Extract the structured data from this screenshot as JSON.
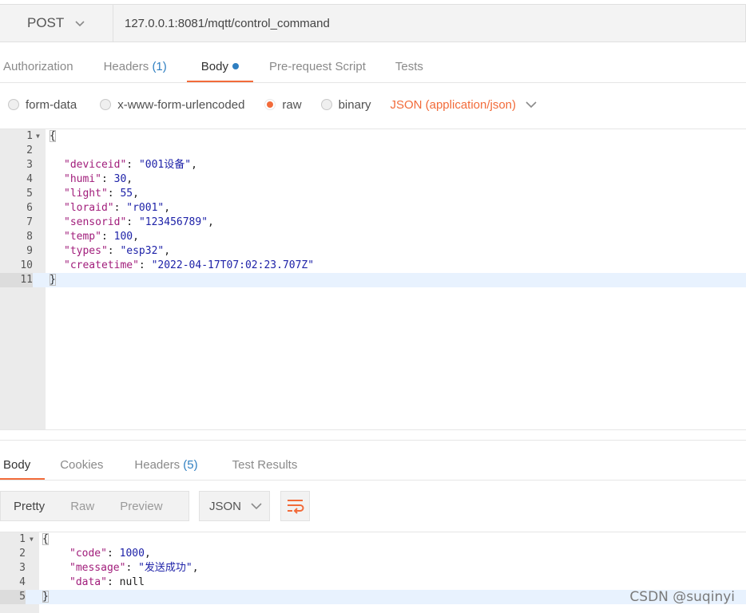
{
  "request": {
    "method": "POST",
    "url": "127.0.0.1:8081/mqtt/control_command"
  },
  "request_tabs": [
    {
      "label": "Authorization"
    },
    {
      "label": "Headers",
      "count": "(1)"
    },
    {
      "label": "Body",
      "active": true
    },
    {
      "label": "Pre-request Script"
    },
    {
      "label": "Tests"
    }
  ],
  "body_options": {
    "form_data": "form-data",
    "urlencoded": "x-www-form-urlencoded",
    "raw": "raw",
    "binary": "binary",
    "selected": "raw",
    "content_type": "JSON (application/json)"
  },
  "request_body": {
    "lines": [
      {
        "n": "1",
        "text": "{"
      },
      {
        "n": "2",
        "text": ""
      },
      {
        "n": "3",
        "key": "\"deviceid\"",
        "val": "\"001设备\"",
        "t": "s"
      },
      {
        "n": "4",
        "key": "\"humi\"",
        "val": "30",
        "t": "n"
      },
      {
        "n": "5",
        "key": "\"light\"",
        "val": "55",
        "t": "n"
      },
      {
        "n": "6",
        "key": "\"loraid\"",
        "val": "\"r001\"",
        "t": "s"
      },
      {
        "n": "7",
        "key": "\"sensorid\"",
        "val": "\"123456789\"",
        "t": "s"
      },
      {
        "n": "8",
        "key": "\"temp\"",
        "val": "100",
        "t": "n"
      },
      {
        "n": "9",
        "key": "\"types\"",
        "val": "\"esp32\"",
        "t": "s"
      },
      {
        "n": "10",
        "key": "\"createtime\"",
        "val": "\"2022-04-17T07:02:23.707Z\"",
        "t": "s",
        "last": true
      },
      {
        "n": "11",
        "text": "}",
        "current": true
      }
    ]
  },
  "response_tabs": [
    {
      "label": "Body",
      "active": true
    },
    {
      "label": "Cookies"
    },
    {
      "label": "Headers",
      "count": "(5)"
    },
    {
      "label": "Test Results"
    }
  ],
  "response_view": {
    "modes": [
      "Pretty",
      "Raw",
      "Preview"
    ],
    "selected_mode": "Pretty",
    "format": "JSON"
  },
  "response_body": {
    "lines": [
      {
        "n": "1",
        "text": "{"
      },
      {
        "n": "2",
        "key": "\"code\"",
        "val": "1000",
        "t": "n"
      },
      {
        "n": "3",
        "key": "\"message\"",
        "val": "\"发送成功\"",
        "t": "s"
      },
      {
        "n": "4",
        "key": "\"data\"",
        "val": "null",
        "t": "lit",
        "last": true
      },
      {
        "n": "5",
        "text": "}",
        "current": true
      }
    ]
  },
  "watermark": "CSDN @suqinyi",
  "colors": {
    "accent": "#f26b3a",
    "link": "#2f7fc1"
  }
}
